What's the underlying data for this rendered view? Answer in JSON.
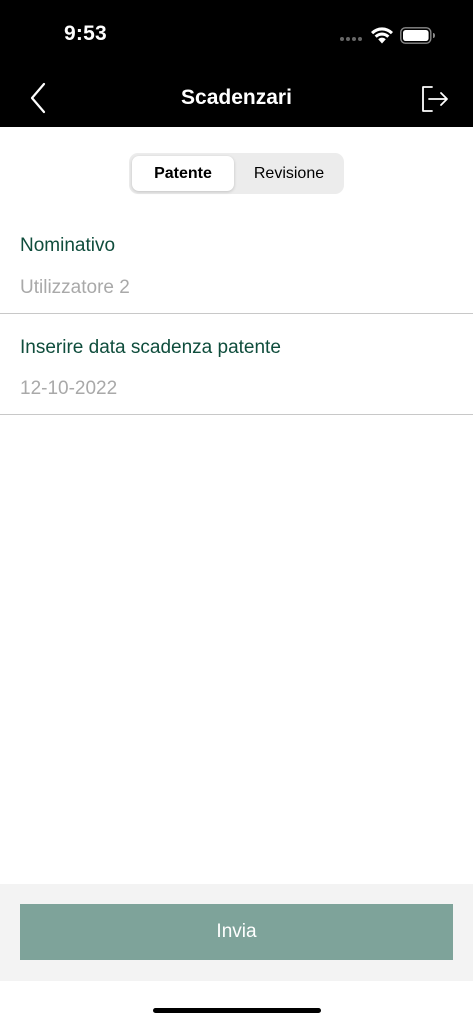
{
  "status_bar": {
    "time": "9:53"
  },
  "nav": {
    "title": "Scadenzari",
    "back_icon": "chevron-left-icon",
    "logout_icon": "logout-icon"
  },
  "segments": {
    "items": [
      {
        "label": "Patente",
        "selected": true
      },
      {
        "label": "Revisione",
        "selected": false
      }
    ]
  },
  "form": {
    "name_field": {
      "label": "Nominativo",
      "value": "Utilizzatore 2"
    },
    "date_field": {
      "label": "Inserire data scadenza patente",
      "value": "12-10-2022"
    }
  },
  "footer": {
    "submit_label": "Invia"
  },
  "colors": {
    "accent_label": "#0f4d3c",
    "button": "#7ea39a",
    "placeholder": "#a9a9a9",
    "bar": "#000000"
  }
}
